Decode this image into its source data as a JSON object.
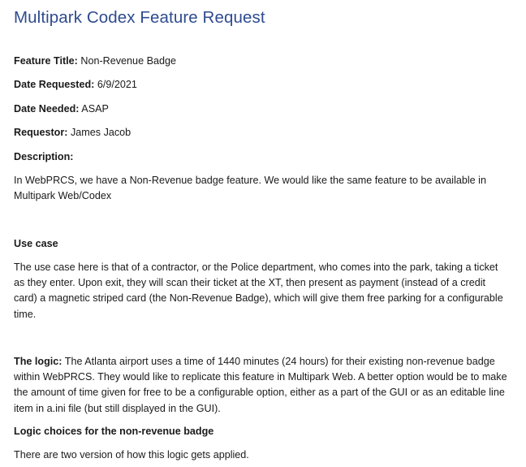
{
  "document": {
    "title": "Multipark Codex Feature Request",
    "fields": {
      "feature_title_label": "Feature Title:",
      "feature_title_value": "Non-Revenue Badge",
      "date_requested_label": "Date Requested:",
      "date_requested_value": "6/9/2021",
      "date_needed_label": "Date Needed:",
      "date_needed_value": "ASAP",
      "requestor_label": "Requestor:",
      "requestor_value": "James Jacob",
      "description_label": "Description:"
    },
    "description_text": "In WebPRCS, we have a Non-Revenue badge feature. We would like the same feature to be available in Multipark Web/Codex",
    "use_case_heading": "Use case",
    "use_case_text": "The use case here is that of a contractor, or the Police department, who comes into the park, taking a ticket as they enter. Upon exit, they will scan their ticket at the XT, then present as payment (instead of a credit card) a magnetic striped card (the Non-Revenue Badge), which will give them free parking for a configurable time.",
    "logic_label": "The logic:",
    "logic_text": "The Atlanta airport uses a time of 1440 minutes (24 hours) for their existing non-revenue badge within WebPRCS. They would like to replicate this feature in Multipark Web. A better option would be to make the amount of time given for free to be a configurable option, either as a part of the GUI or as an editable line item in a.ini file (but still displayed in the GUI).",
    "logic_choices_heading": "Logic choices for the non-revenue badge",
    "versions_text": "There are two version of how this logic gets applied."
  }
}
